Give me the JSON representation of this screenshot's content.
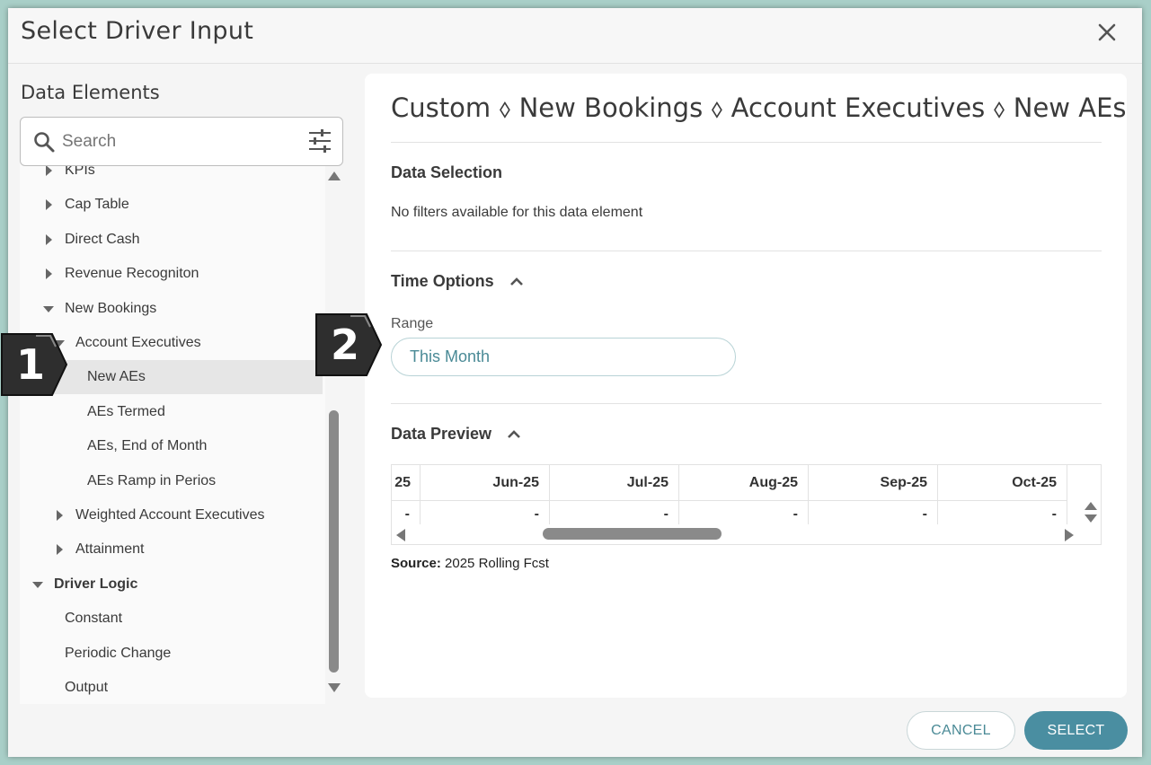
{
  "dialog": {
    "title": "Select Driver Input",
    "close_icon": "close-icon"
  },
  "left": {
    "title": "Data Elements",
    "search": {
      "placeholder": "Search",
      "value": ""
    },
    "tree": [
      {
        "label": "KPIs",
        "level": 1,
        "caret": "right"
      },
      {
        "label": "Cap Table",
        "level": 1,
        "caret": "right"
      },
      {
        "label": "Direct Cash",
        "level": 1,
        "caret": "right"
      },
      {
        "label": "Revenue Recogniton",
        "level": 1,
        "caret": "right"
      },
      {
        "label": "New Bookings",
        "level": 1,
        "caret": "down"
      },
      {
        "label": "Account Executives",
        "level": 2,
        "caret": "down"
      },
      {
        "label": "New AEs",
        "level": 3,
        "caret": "none",
        "selected": true
      },
      {
        "label": "AEs Termed",
        "level": 3,
        "caret": "none"
      },
      {
        "label": "AEs, End of Month",
        "level": 3,
        "caret": "none"
      },
      {
        "label": "AEs Ramp in Perios",
        "level": 3,
        "caret": "none"
      },
      {
        "label": "Weighted Account Executives",
        "level": 2,
        "caret": "right"
      },
      {
        "label": "Attainment",
        "level": 2,
        "caret": "right"
      },
      {
        "label": "Driver Logic",
        "level": 0,
        "caret": "down",
        "bold": true
      },
      {
        "label": "Constant",
        "level": 1,
        "caret": "none"
      },
      {
        "label": "Periodic Change",
        "level": 1,
        "caret": "none"
      },
      {
        "label": "Output",
        "level": 1,
        "caret": "none"
      }
    ]
  },
  "right": {
    "breadcrumb": "Custom ⬨ New Bookings ⬨ Account Executives ⬨ New AEs",
    "data_selection": {
      "heading": "Data Selection",
      "message": "No filters available for this data element"
    },
    "time_options": {
      "heading": "Time Options",
      "range_label": "Range",
      "range_value": "This Month"
    },
    "data_preview": {
      "heading": "Data Preview",
      "columns": [
        "25",
        "Jun-25",
        "Jul-25",
        "Aug-25",
        "Sep-25",
        "Oct-25"
      ],
      "values": [
        "-",
        "-",
        "-",
        "-",
        "-",
        "-"
      ],
      "source_label": "Source:",
      "source_value": "2025 Rolling Fcst"
    }
  },
  "footer": {
    "cancel_label": "CANCEL",
    "select_label": "SELECT"
  },
  "callouts": [
    "1",
    "2"
  ],
  "colors": {
    "accent": "#4a8ea1",
    "accent_text": "#4a8a96",
    "backdrop": "#a9cfc8",
    "callout": "#2e2e2e"
  }
}
